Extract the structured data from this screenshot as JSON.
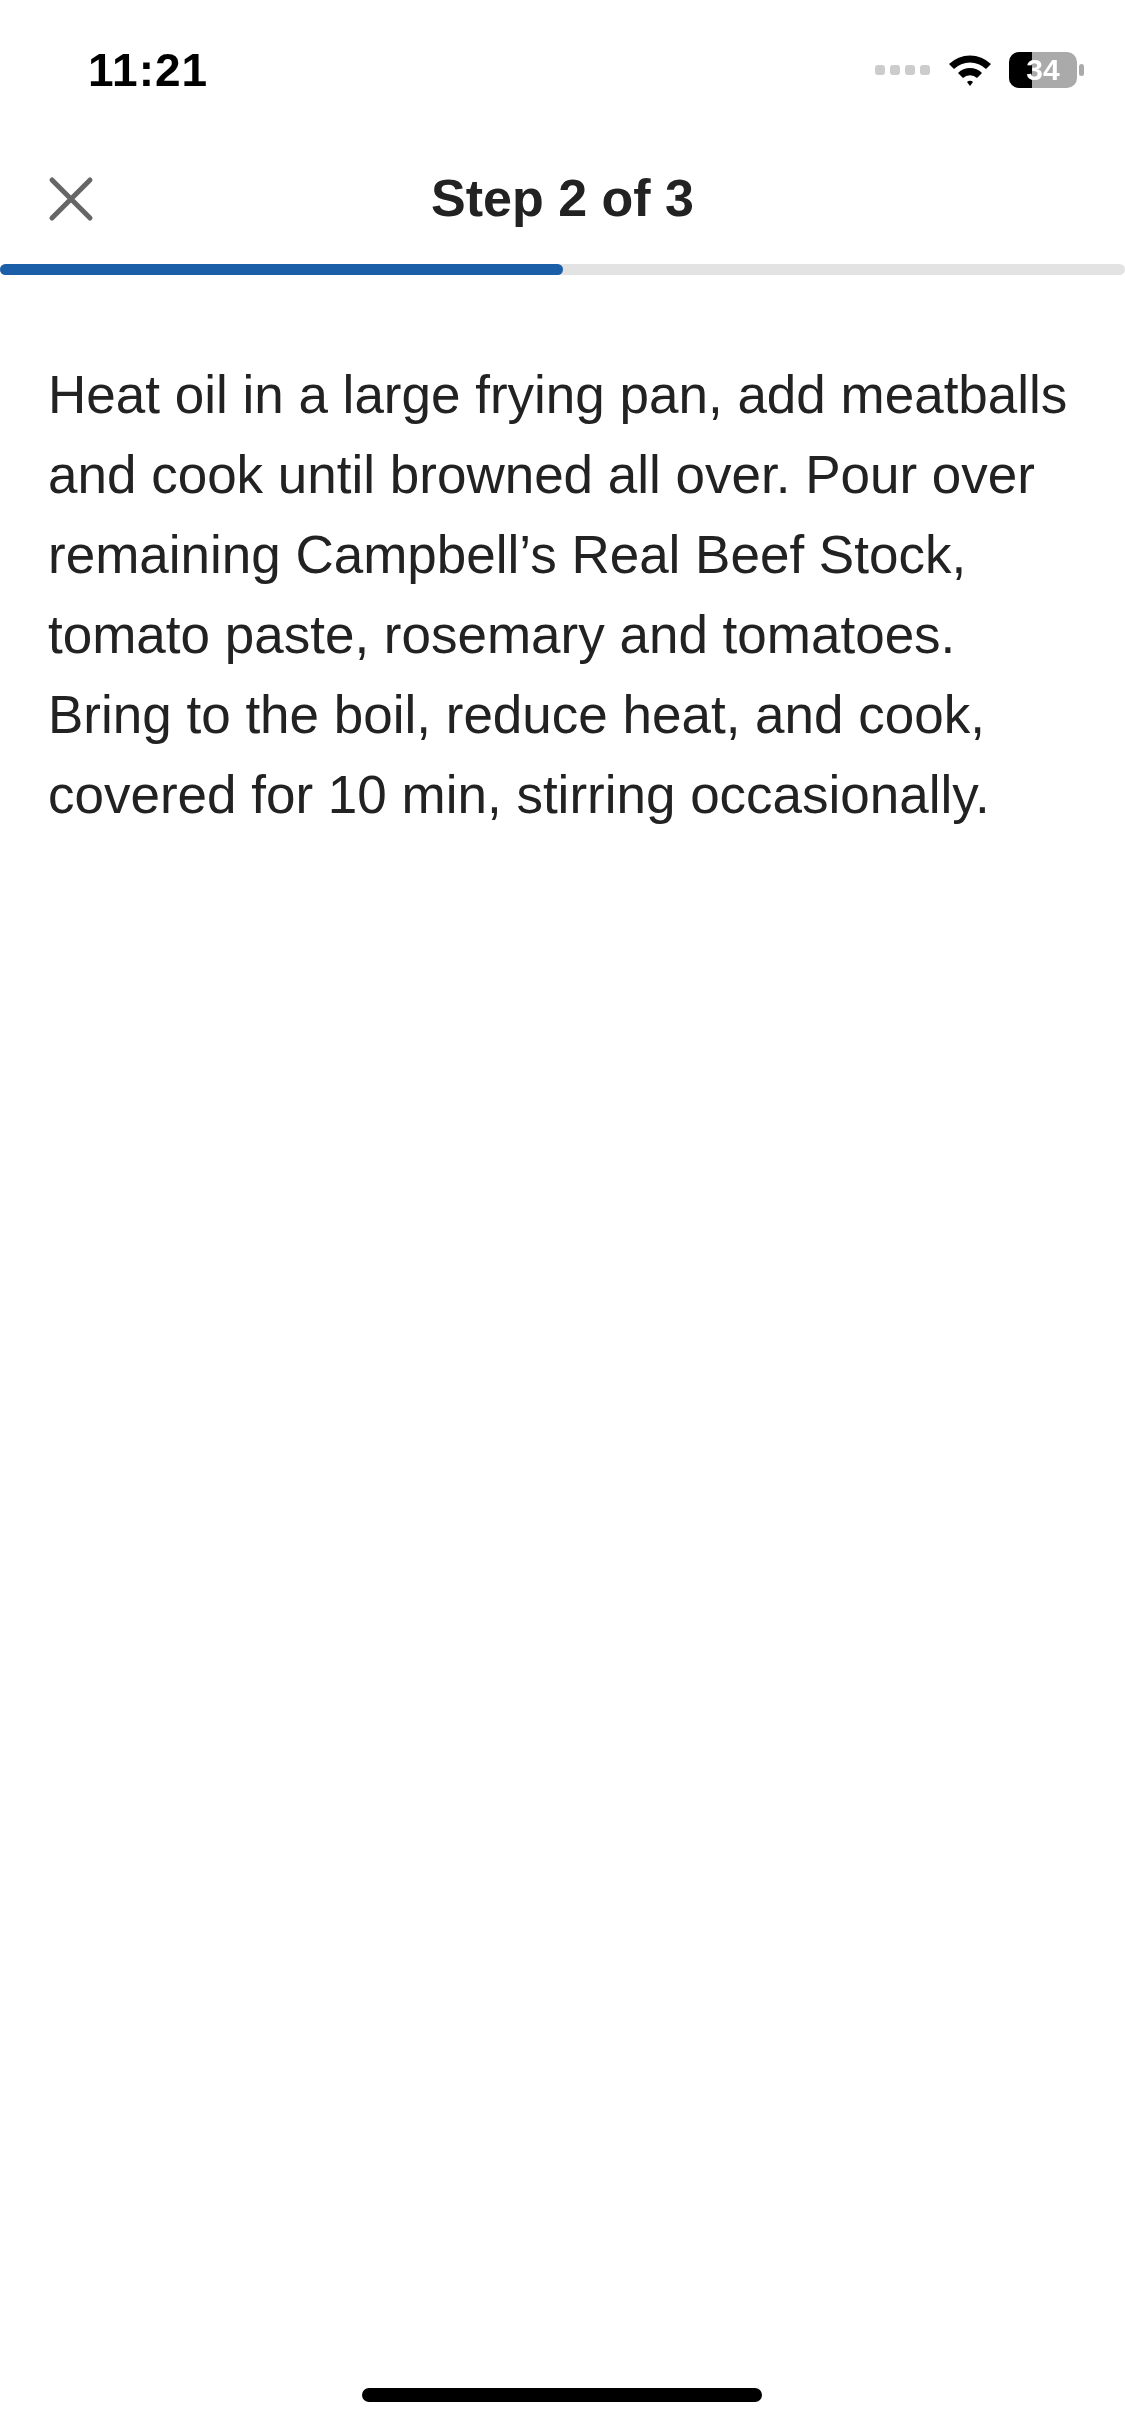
{
  "status_bar": {
    "time": "11:21",
    "battery": "34"
  },
  "header": {
    "title": "Step 2 of 3"
  },
  "progress": {
    "level": 0.5
  },
  "step_text": "Heat oil in a large frying pan, add meatballs and cook until browned all over. Pour over remaining Campbell’s Real Beef Stock, tomato paste, rosemary and tomatoes. Bring to the boil, reduce heat, and cook, covered for 10 min, stirring occasionally."
}
